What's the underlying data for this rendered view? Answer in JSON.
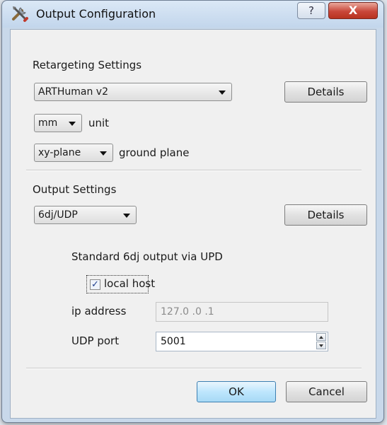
{
  "window": {
    "title": "Output Configuration",
    "help_glyph": "?",
    "close_glyph": "X",
    "icon": "tools-icon"
  },
  "retargeting": {
    "heading": "Retargeting Settings",
    "model_selected": "ARTHuman v2",
    "details_label": "Details",
    "unit_selected": "mm",
    "unit_label": "unit",
    "plane_selected": "xy-plane",
    "plane_label": "ground plane"
  },
  "output": {
    "heading": "Output Settings",
    "format_selected": "6dj/UDP",
    "details_label": "Details",
    "description": "Standard 6dj output via UPD",
    "local_host_label": "local host",
    "local_host_checked": true,
    "ip_label": "ip address",
    "ip_value": "127.0  .0  .1",
    "port_label": "UDP port",
    "port_value": "5001"
  },
  "footer": {
    "ok_label": "OK",
    "cancel_label": "Cancel"
  },
  "colors": {
    "close_button": "#c9473a",
    "default_button": "#bee6fd",
    "titlebar": "#c8d8ea"
  }
}
